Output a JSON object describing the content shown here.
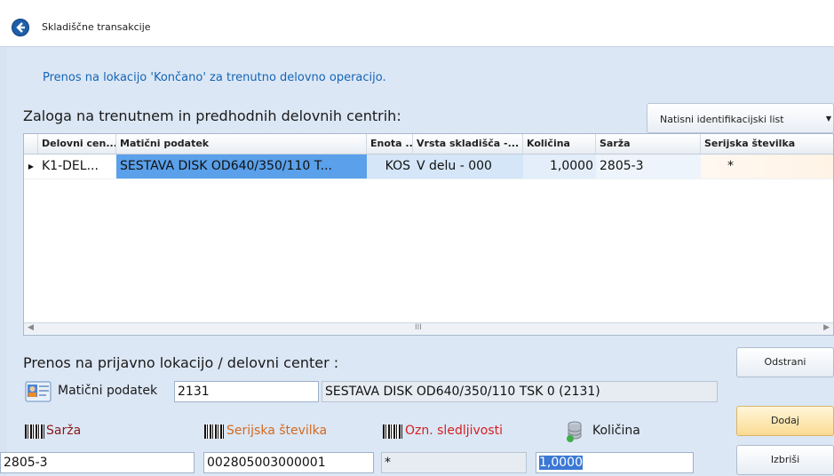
{
  "window": {
    "title": "Skladiščne transakcije"
  },
  "info_text": "Prenos na lokacijo 'Končano' za trenutno delovno operacijo.",
  "stock": {
    "heading": "Zaloga na trenutnem in predhodnih delovnih centrih:",
    "print_button": "Natisni identifikacijski list",
    "columns": [
      "Delovni cen...",
      "Matični podatek",
      "Enota ...",
      "Vrsta skladišča -...",
      "Količina",
      "Sarža",
      "Serijska številka"
    ],
    "rows": [
      {
        "workcenter": "K1-DEL...",
        "item": "SESTAVA DISK OD640/350/110 T...",
        "unit": "KOS",
        "type": "V delu - 000",
        "qty": "1,0000",
        "batch": "2805-3",
        "serial": "*"
      }
    ],
    "scroll_thumb": "III"
  },
  "transfer": {
    "heading": "Prenos na prijavno lokacijo / delovni center :",
    "item_label": "Matični podatek",
    "item_code": "2131",
    "item_name": "SESTAVA DISK OD640/350/110 TSK 0 (2131)",
    "batch_label": "Sarža",
    "batch_value": "2805-3",
    "serial_label": "Serijska številka",
    "serial_value": "002805003000001",
    "trace_label": "Ozn. sledljivosti",
    "trace_value": "*",
    "qty_label": "Količina",
    "qty_value": "1,0000"
  },
  "actions": {
    "remove": "Odstrani",
    "add": "Dodaj",
    "delete": "Izbriši"
  },
  "colors": {
    "accent": "#1565b5",
    "selection": "#5aa0ea",
    "batch_label": "#8b1a1a",
    "serial_label": "#d2691e",
    "trace_label": "#d61f1f"
  }
}
